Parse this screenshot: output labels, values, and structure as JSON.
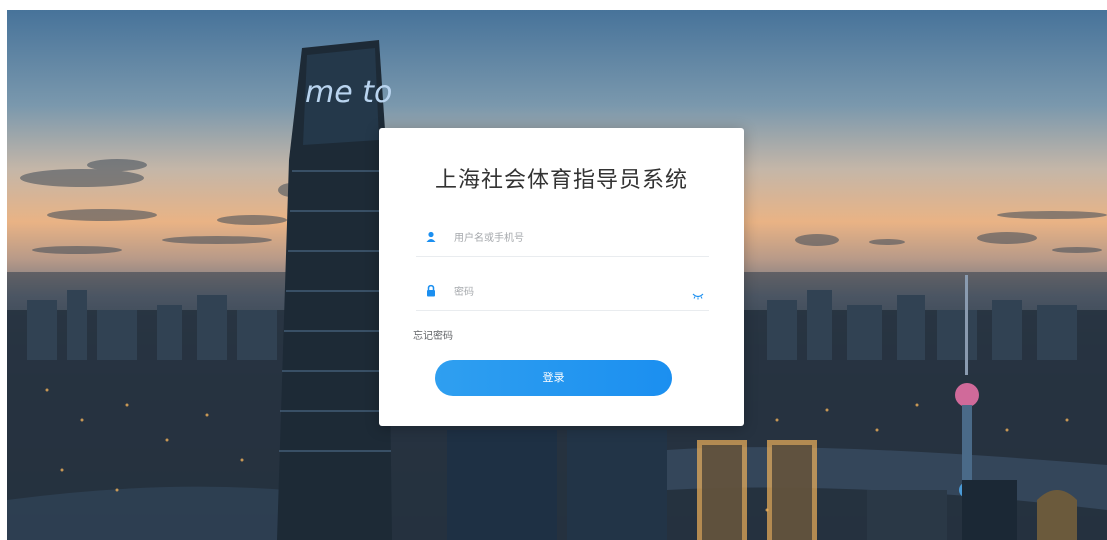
{
  "login": {
    "title": "上海社会体育指导员系统",
    "username_placeholder": "用户名或手机号",
    "username_value": "",
    "password_placeholder": "密码",
    "password_value": "",
    "forgot_label": "忘记密码",
    "submit_label": "登录"
  },
  "background": {
    "tower_sign": "me to"
  },
  "colors": {
    "accent": "#1b8ff0",
    "card": "#ffffff"
  },
  "icons": [
    "user-icon",
    "lock-icon",
    "eye-closed-icon"
  ]
}
